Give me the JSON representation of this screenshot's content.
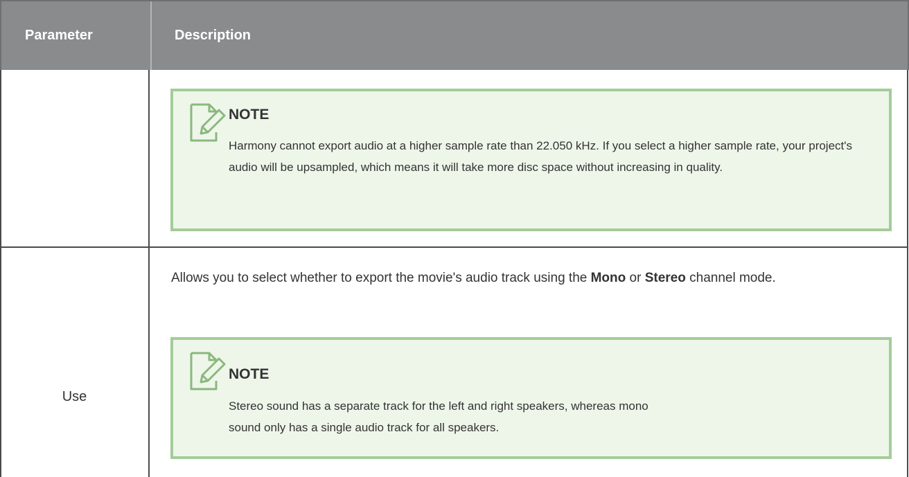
{
  "table": {
    "headers": {
      "parameter": "Parameter",
      "description": "Description"
    },
    "rows": [
      {
        "parameter": "",
        "description": {
          "note": {
            "title": "NOTE",
            "text": "Harmony cannot export audio at a higher sample rate than 22.050 kHz. If you select a higher sample rate, your project's audio will be upsampled, which means it will take more disc space without increasing in quality."
          }
        }
      },
      {
        "parameter": "Use",
        "description": {
          "text_before_mono": "Allows you to select whether to export the movie's audio track using the ",
          "mono": "Mono",
          "text_or": " or ",
          "stereo": "Stereo",
          "text_after_stereo": " channel mode.",
          "note": {
            "title": "NOTE",
            "text": "Stereo sound has a separate track for the left and right speakers, whereas mono sound only has a single audio track for all speakers."
          }
        }
      }
    ]
  },
  "colors": {
    "header_bg": "#8a8b8d",
    "note_bg": "#eef6ea",
    "note_border": "#a4cc99",
    "icon_stroke": "#8ab87d"
  },
  "icons": {
    "note_icon": "note-pencil-icon"
  }
}
